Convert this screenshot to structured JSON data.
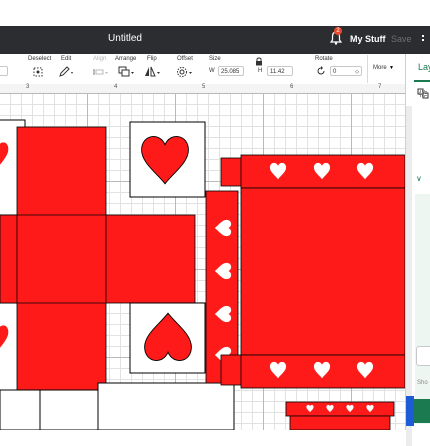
{
  "titlebar": {
    "title": "Untitled",
    "notification_count": "2",
    "my_stuff": "My Stuff",
    "save": "Save"
  },
  "toolbar": {
    "deselect": "Deselect",
    "edit": "Edit",
    "align": "Align",
    "arrange": "Arrange",
    "flip": "Flip",
    "offset": "Offset",
    "size": "Size",
    "w_label": "W",
    "w_value": "25.085",
    "h_label": "H",
    "h_value": "11.42",
    "rotate": "Rotate",
    "rotate_value": "0",
    "more": "More"
  },
  "rightpanel": {
    "tab": "Lay",
    "show": "Sho"
  },
  "ruler": {
    "numbers": [
      "3",
      "4",
      "5",
      "6",
      "7"
    ]
  },
  "colors": {
    "accent": "#1a7a4f",
    "shape_red": "#ff1a1a",
    "titlebar": "#2b2d31"
  }
}
